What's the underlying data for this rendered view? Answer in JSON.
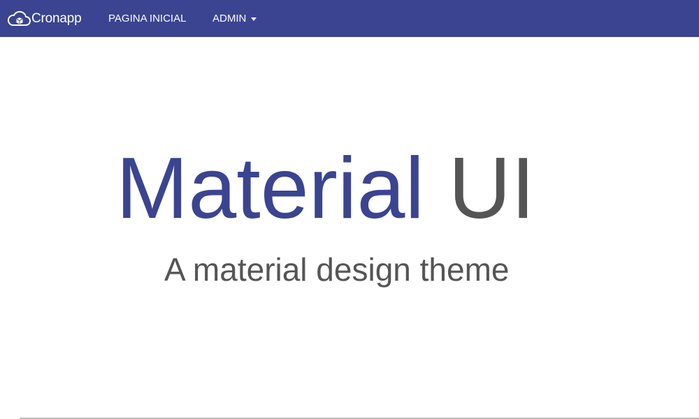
{
  "colors": {
    "primary": "#3b4490",
    "text_gray": "#555555",
    "background": "#ffffff"
  },
  "navbar": {
    "brand": {
      "icon": "cloud-cube-icon",
      "name": "Cronapp"
    },
    "items": [
      {
        "label": "PAGINA INICIAL"
      },
      {
        "label": "ADMIN",
        "icon": "caret-down-icon"
      }
    ]
  },
  "hero": {
    "title_primary": "Material",
    "title_secondary": "UI",
    "subtitle": "A material design theme"
  }
}
